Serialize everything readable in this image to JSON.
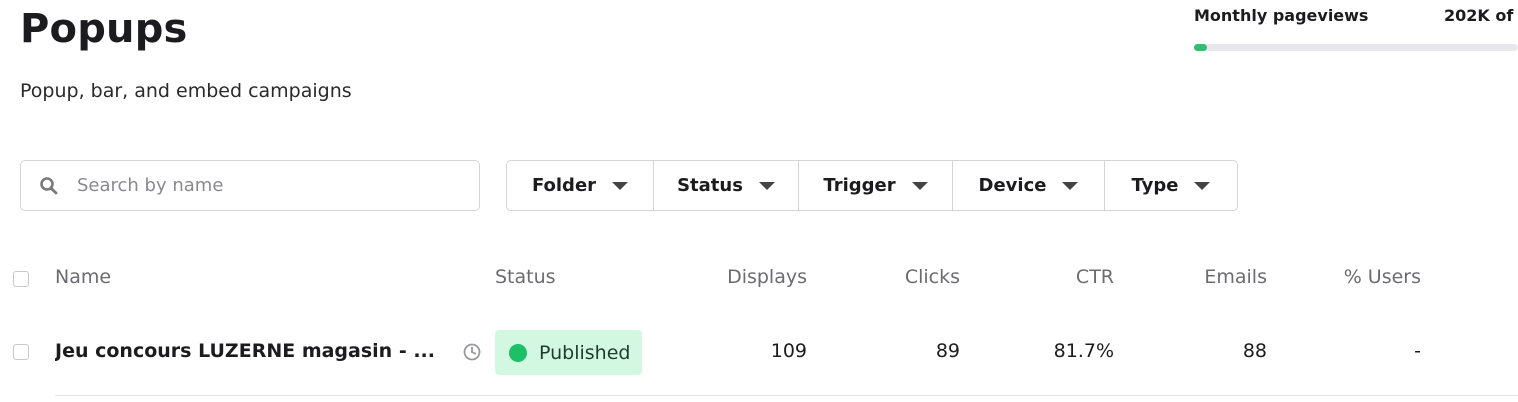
{
  "header": {
    "title": "Popups",
    "subtitle": "Popup, bar, and embed campaigns"
  },
  "usage": {
    "label": "Monthly pageviews",
    "value": "202K of",
    "progress_fraction": 0.04,
    "accent_color": "#2fbf71"
  },
  "search": {
    "placeholder": "Search by name",
    "value": ""
  },
  "filters": [
    {
      "label": "Folder"
    },
    {
      "label": "Status"
    },
    {
      "label": "Trigger"
    },
    {
      "label": "Device"
    },
    {
      "label": "Type"
    }
  ],
  "table": {
    "columns": {
      "name": "Name",
      "status": "Status",
      "displays": "Displays",
      "clicks": "Clicks",
      "ctr": "CTR",
      "emails": "Emails",
      "users": "% Users"
    },
    "rows": [
      {
        "name": "Jeu concours LUZERNE magasin - ...",
        "status": "Published",
        "status_color": "#1dbf67",
        "displays": "109",
        "clicks": "89",
        "ctr": "81.7%",
        "emails": "88",
        "users": "-"
      }
    ]
  },
  "icons": {
    "search": "search-icon",
    "clock": "clock-icon",
    "caret": "caret-down-icon"
  }
}
